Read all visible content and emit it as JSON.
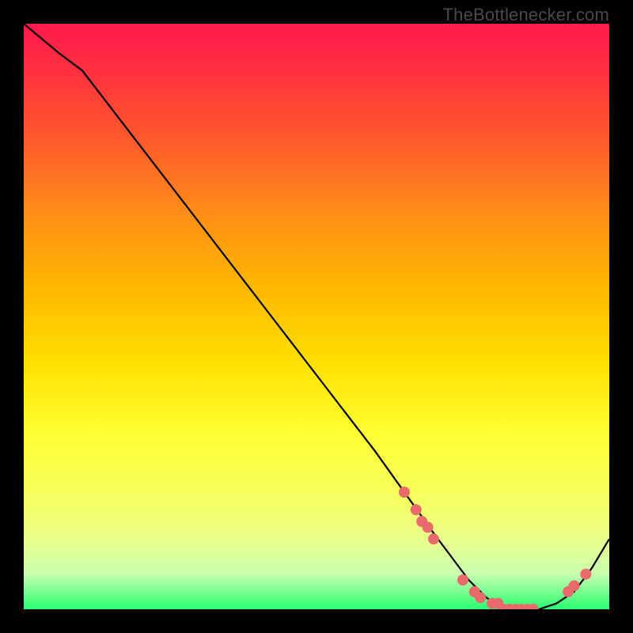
{
  "brand": "TheBottlenecker.com",
  "chart_data": {
    "type": "line",
    "title": "",
    "xlabel": "",
    "ylabel": "",
    "xlim": [
      0,
      100
    ],
    "ylim": [
      0,
      100
    ],
    "grid": false,
    "legend": false,
    "x": [
      0,
      6,
      10,
      20,
      30,
      40,
      50,
      60,
      65,
      70,
      73,
      76,
      79,
      82,
      85,
      88,
      91,
      94,
      97,
      100
    ],
    "values": [
      100,
      95,
      92,
      79,
      66,
      53,
      40,
      27,
      20,
      13,
      9,
      5,
      2,
      0,
      0,
      0,
      1,
      3,
      7,
      12
    ],
    "markers": {
      "color": "#e86a6a",
      "points": [
        {
          "x": 65,
          "y": 20
        },
        {
          "x": 67,
          "y": 17
        },
        {
          "x": 68,
          "y": 15
        },
        {
          "x": 69,
          "y": 14
        },
        {
          "x": 70,
          "y": 12
        },
        {
          "x": 75,
          "y": 5
        },
        {
          "x": 77,
          "y": 3
        },
        {
          "x": 78,
          "y": 2
        },
        {
          "x": 80,
          "y": 1
        },
        {
          "x": 81,
          "y": 1
        },
        {
          "x": 82,
          "y": 0
        },
        {
          "x": 83,
          "y": 0
        },
        {
          "x": 84,
          "y": 0
        },
        {
          "x": 85,
          "y": 0
        },
        {
          "x": 86,
          "y": 0
        },
        {
          "x": 87,
          "y": 0
        },
        {
          "x": 93,
          "y": 3
        },
        {
          "x": 94,
          "y": 4
        },
        {
          "x": 96,
          "y": 6
        }
      ]
    }
  }
}
